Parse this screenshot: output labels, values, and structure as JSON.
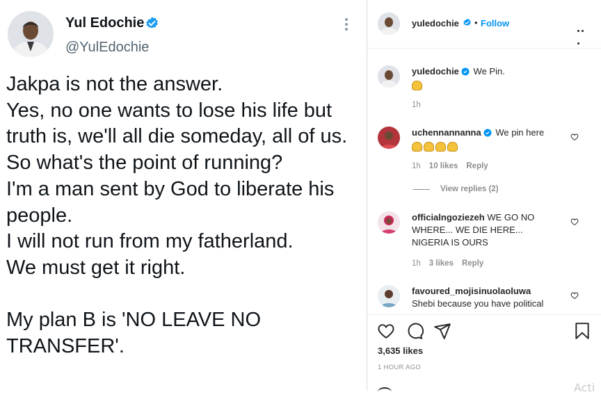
{
  "tweet": {
    "name": "Yul Edochie",
    "handle": "@YulEdochie",
    "body": "Jakpa is not the answer.\nYes, no one wants to lose his life but truth is, we'll all die someday, all of us.\nSo what's the point of running?\nI'm a man sent by God to liberate his people.\nI will not run from my fatherland.\nWe must get it right.\n\nMy plan B is 'NO LEAVE NO TRANSFER'."
  },
  "post": {
    "username": "yuledochie",
    "follow_label": "Follow",
    "dot": "•",
    "caption": "We Pin.",
    "caption_time": "1h"
  },
  "comments": [
    {
      "username": "uchennannanna",
      "text": "We pin here",
      "time": "1h",
      "likes": "10 likes",
      "reply": "Reply",
      "view_replies": "View replies (2)"
    },
    {
      "username": "officialngoziezeh",
      "text": "WE GO NO WHERE... WE DIE HERE... NIGERIA IS OURS",
      "time": "1h",
      "likes": "3 likes",
      "reply": "Reply"
    },
    {
      "username": "favoured_mojisinuolaoluwa",
      "text": "Shebi because you have political"
    }
  ],
  "footer": {
    "likes": "3,635 likes",
    "time": "1 HOUR AGO"
  },
  "watermark": "Acti",
  "colors": {
    "accent": "#0095f6",
    "twitter_verified": "#1d9bf0",
    "text": "#262626",
    "muted": "#8e8e8e"
  },
  "icons": [
    "verified-badge-icon",
    "more-options-icon",
    "heart-icon",
    "comment-icon",
    "share-icon",
    "bookmark-icon"
  ]
}
